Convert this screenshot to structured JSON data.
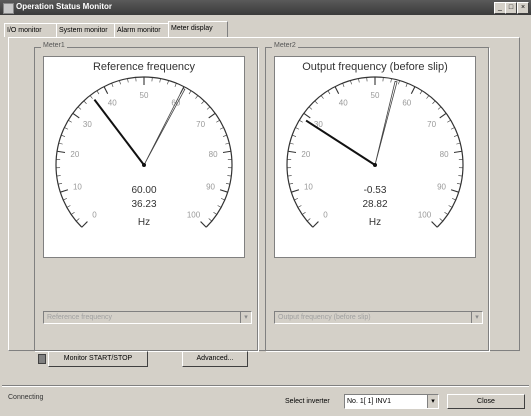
{
  "window": {
    "title": "Operation Status Monitor"
  },
  "titlebar_buttons": {
    "minimize": "_",
    "maximize": "□",
    "close": "×"
  },
  "tabs": [
    {
      "label": "I/O monitor"
    },
    {
      "label": "System monitor"
    },
    {
      "label": "Alarm monitor"
    },
    {
      "label": "Meter display"
    }
  ],
  "meters": [
    {
      "group_label": "Meter1",
      "title": "Reference frequency",
      "value1": "60.00",
      "value2": "36.23",
      "unit": "Hz",
      "ticks": [
        "0",
        "10",
        "20",
        "30",
        "40",
        "50",
        "60",
        "70",
        "80",
        "90",
        "100"
      ],
      "needle_value": 36.23,
      "peak_value": 60.0,
      "selector": "Reference frequency"
    },
    {
      "group_label": "Meter2",
      "title": "Output frequency (before slip)",
      "value1": "-0.53",
      "value2": "28.82",
      "unit": "Hz",
      "ticks": [
        "0",
        "10",
        "20",
        "30",
        "40",
        "50",
        "60",
        "70",
        "80",
        "90",
        "100"
      ],
      "needle_value": 28.82,
      "peak_value": 55.0,
      "selector": "Output frequency (before slip)"
    }
  ],
  "controls": {
    "start_stop": "Monitor START/STOP",
    "advanced": "Advanced..."
  },
  "status": {
    "connection": "Connecting",
    "select_inverter_label": "Select inverter",
    "select_inverter_value": "No. 1[ 1] INV1",
    "close": "Close"
  }
}
